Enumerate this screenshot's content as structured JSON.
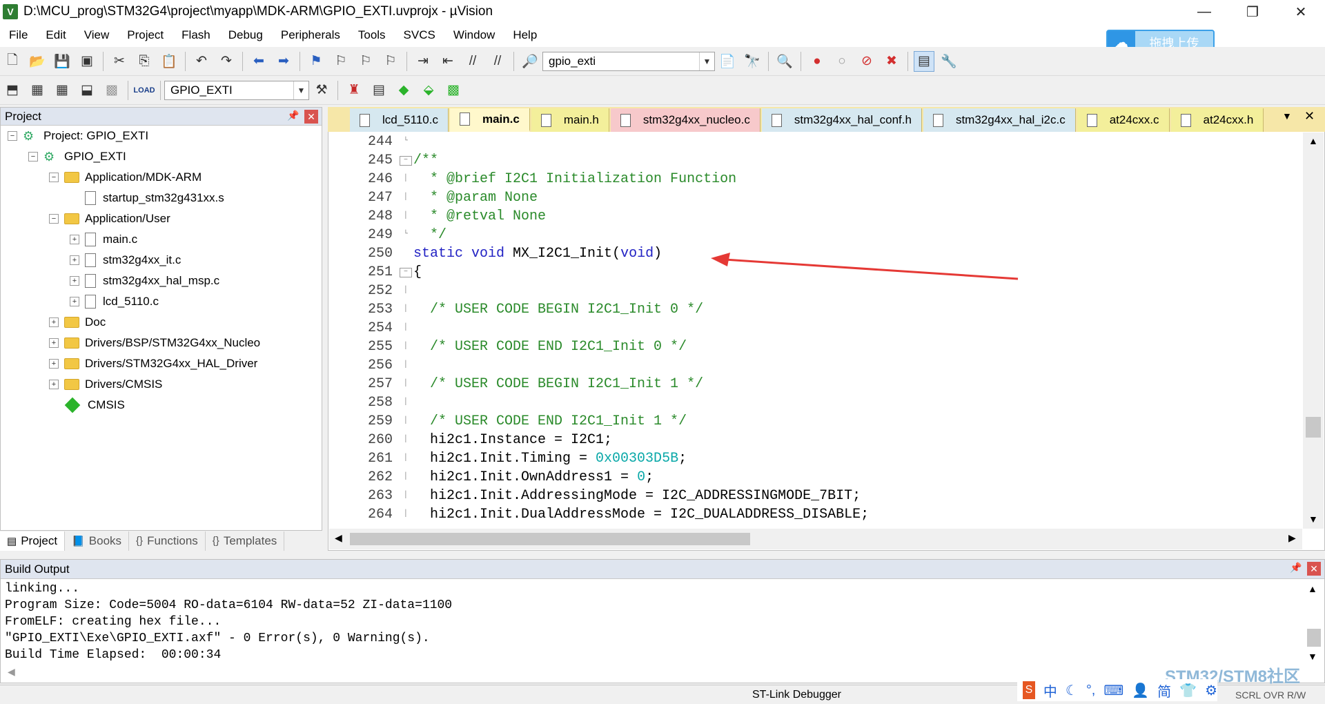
{
  "window": {
    "title": "D:\\MCU_prog\\STM32G4\\project\\myapp\\MDK-ARM\\GPIO_EXTI.uvprojx - µVision",
    "app_icon": "V"
  },
  "menu": [
    "File",
    "Edit",
    "View",
    "Project",
    "Flash",
    "Debug",
    "Peripherals",
    "Tools",
    "SVCS",
    "Window",
    "Help"
  ],
  "upload_button": {
    "label": "拖拽上传"
  },
  "toolbar1": {
    "find_combo": "gpio_exti"
  },
  "toolbar2": {
    "target_combo": "GPIO_EXTI"
  },
  "project_panel": {
    "title": "Project",
    "tree": [
      {
        "label": "Project: GPIO_EXTI",
        "type": "project",
        "toggle": "−"
      },
      {
        "label": "GPIO_EXTI",
        "type": "target",
        "toggle": "−"
      },
      {
        "label": "Application/MDK-ARM",
        "type": "folder",
        "toggle": "−"
      },
      {
        "label": "startup_stm32g431xx.s",
        "type": "file",
        "toggle": ""
      },
      {
        "label": "Application/User",
        "type": "folder",
        "toggle": "−"
      },
      {
        "label": "main.c",
        "type": "file",
        "toggle": "+"
      },
      {
        "label": "stm32g4xx_it.c",
        "type": "file",
        "toggle": "+"
      },
      {
        "label": "stm32g4xx_hal_msp.c",
        "type": "file",
        "toggle": "+"
      },
      {
        "label": "lcd_5110.c",
        "type": "file",
        "toggle": "+"
      },
      {
        "label": "Doc",
        "type": "folder",
        "toggle": "+"
      },
      {
        "label": "Drivers/BSP/STM32G4xx_Nucleo",
        "type": "folder",
        "toggle": "+"
      },
      {
        "label": "Drivers/STM32G4xx_HAL_Driver",
        "type": "folder",
        "toggle": "+"
      },
      {
        "label": "Drivers/CMSIS",
        "type": "folder",
        "toggle": "+"
      },
      {
        "label": "CMSIS",
        "type": "component",
        "toggle": ""
      }
    ],
    "tabs": [
      "Project",
      "Books",
      "Functions",
      "Templates"
    ]
  },
  "editor": {
    "tabs": [
      {
        "label": "lcd_5110.c",
        "kind": "c"
      },
      {
        "label": "main.c",
        "kind": "active"
      },
      {
        "label": "main.h",
        "kind": "h"
      },
      {
        "label": "stm32g4xx_nucleo.c",
        "kind": "red"
      },
      {
        "label": "stm32g4xx_hal_conf.h",
        "kind": "c"
      },
      {
        "label": "stm32g4xx_hal_i2c.c",
        "kind": "c"
      },
      {
        "label": "at24cxx.c",
        "kind": "h"
      },
      {
        "label": "at24cxx.h",
        "kind": "h"
      }
    ],
    "lines": [
      {
        "n": "244",
        "fold": "end",
        "seg": []
      },
      {
        "n": "245",
        "fold": "box",
        "seg": [
          {
            "t": "/**",
            "c": "cmt"
          }
        ]
      },
      {
        "n": "246",
        "fold": "line",
        "seg": [
          {
            "t": "  * @brief I2C1 Initialization Function",
            "c": "cmt"
          }
        ]
      },
      {
        "n": "247",
        "fold": "line",
        "seg": [
          {
            "t": "  * @param None",
            "c": "cmt"
          }
        ]
      },
      {
        "n": "248",
        "fold": "line",
        "seg": [
          {
            "t": "  * @retval None",
            "c": "cmt"
          }
        ]
      },
      {
        "n": "249",
        "fold": "end",
        "seg": [
          {
            "t": "  */",
            "c": "cmt"
          }
        ]
      },
      {
        "n": "250",
        "fold": "",
        "seg": [
          {
            "t": "static void ",
            "c": "kw"
          },
          {
            "t": "MX_I2C1_Init(",
            "c": "codetxt"
          },
          {
            "t": "void",
            "c": "kw"
          },
          {
            "t": ")",
            "c": "codetxt"
          }
        ]
      },
      {
        "n": "251",
        "fold": "box",
        "seg": [
          {
            "t": "{",
            "c": "codetxt"
          }
        ]
      },
      {
        "n": "252",
        "fold": "line",
        "seg": []
      },
      {
        "n": "253",
        "fold": "line",
        "seg": [
          {
            "t": "  /* USER CODE BEGIN I2C1_Init 0 */",
            "c": "cmt"
          }
        ]
      },
      {
        "n": "254",
        "fold": "line",
        "seg": []
      },
      {
        "n": "255",
        "fold": "line",
        "seg": [
          {
            "t": "  /* USER CODE END I2C1_Init 0 */",
            "c": "cmt"
          }
        ]
      },
      {
        "n": "256",
        "fold": "line",
        "seg": []
      },
      {
        "n": "257",
        "fold": "line",
        "seg": [
          {
            "t": "  /* USER CODE BEGIN I2C1_Init 1 */",
            "c": "cmt"
          }
        ]
      },
      {
        "n": "258",
        "fold": "line",
        "seg": []
      },
      {
        "n": "259",
        "fold": "line",
        "seg": [
          {
            "t": "  /* USER CODE END I2C1_Init 1 */",
            "c": "cmt"
          }
        ]
      },
      {
        "n": "260",
        "fold": "line",
        "seg": [
          {
            "t": "  hi2c1.Instance = I2C1;",
            "c": "codetxt"
          }
        ]
      },
      {
        "n": "261",
        "fold": "line",
        "seg": [
          {
            "t": "  hi2c1.Init.Timing = ",
            "c": "codetxt"
          },
          {
            "t": "0x00303D5B",
            "c": "num"
          },
          {
            "t": ";",
            "c": "codetxt"
          }
        ]
      },
      {
        "n": "262",
        "fold": "line",
        "seg": [
          {
            "t": "  hi2c1.Init.OwnAddress1 = ",
            "c": "codetxt"
          },
          {
            "t": "0",
            "c": "num"
          },
          {
            "t": ";",
            "c": "codetxt"
          }
        ]
      },
      {
        "n": "263",
        "fold": "line",
        "seg": [
          {
            "t": "  hi2c1.Init.AddressingMode = I2C_ADDRESSINGMODE_7BIT;",
            "c": "codetxt"
          }
        ]
      },
      {
        "n": "264",
        "fold": "line",
        "seg": [
          {
            "t": "  hi2c1.Init.DualAddressMode = I2C_DUALADDRESS_DISABLE;",
            "c": "codetxt"
          }
        ]
      }
    ]
  },
  "build_output": {
    "title": "Build Output",
    "lines": [
      "linking...",
      "Program Size: Code=5004 RO-data=6104 RW-data=52 ZI-data=1100",
      "FromELF: creating hex file...",
      "\"GPIO_EXTI\\Exe\\GPIO_EXTI.axf\" - 0 Error(s), 0 Warning(s).",
      "Build Time Elapsed:  00:00:34"
    ]
  },
  "status": {
    "debugger": "ST-Link Debugger",
    "modes": "SCRL OVR R/W"
  },
  "watermark": "STM32/STM8社区",
  "ime": [
    "中",
    "简"
  ],
  "colors": {
    "arrow": "#e53935",
    "comment": "#2a8a2a",
    "keyword": "#2222c4",
    "number": "#0aa8a8",
    "tab_bar": "#f6e7a8"
  }
}
